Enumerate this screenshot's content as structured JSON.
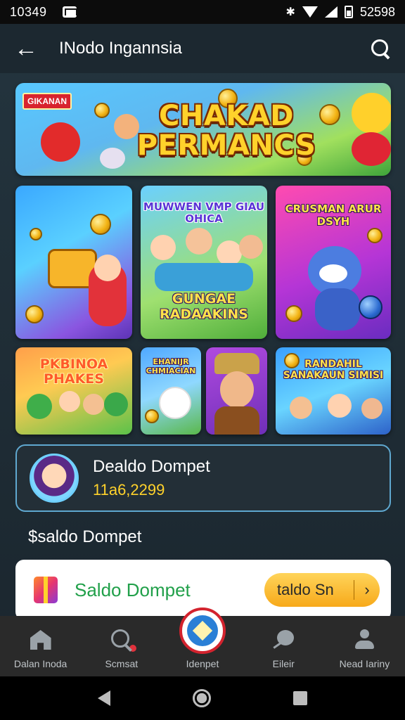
{
  "status_bar": {
    "time": "10349",
    "right_text": "52598"
  },
  "app_bar": {
    "title": "INodo Ingannsia"
  },
  "banner": {
    "tag": "GIKANAN",
    "headline": "CHAKAD PERMANCS"
  },
  "tiles": {
    "t2_top": "MUWWEN VMP GIAU OHICA",
    "t2_bottom": "GUNGAE RADAAKINS",
    "t3_top": "CRUSMAN ARUR DSYH",
    "t4": "PKBINOA PHAKES",
    "t5": "EHANIJR CHMIACIAN",
    "t7": "RANDAHIL SANAKAUN SIMISI"
  },
  "wallet": {
    "name": "Dealdo Dompet",
    "amount": "11a6,2299"
  },
  "section": {
    "title": "$saldo Dompet"
  },
  "promo": {
    "title": "Saldo Dompet",
    "button": "taldo Sn",
    "chevron": "›"
  },
  "bottom_nav": [
    {
      "label": "Dalan Inoda"
    },
    {
      "label": "Scmsat"
    },
    {
      "label": "Idenpet"
    },
    {
      "label": "Eileir"
    },
    {
      "label": "Nead Iariny"
    }
  ],
  "colors": {
    "accent_yellow": "#ffd22b",
    "wallet_border": "#5fa8d0",
    "promo_green": "#21a04a",
    "nav_red": "#d3232e"
  },
  "icons": [
    "back-arrow-icon",
    "search-icon",
    "mail-icon",
    "bluetooth-icon",
    "wifi-icon",
    "signal-icon",
    "battery-icon",
    "home-icon",
    "chat-icon",
    "user-icon",
    "gift-icon",
    "diamond-icon"
  ]
}
